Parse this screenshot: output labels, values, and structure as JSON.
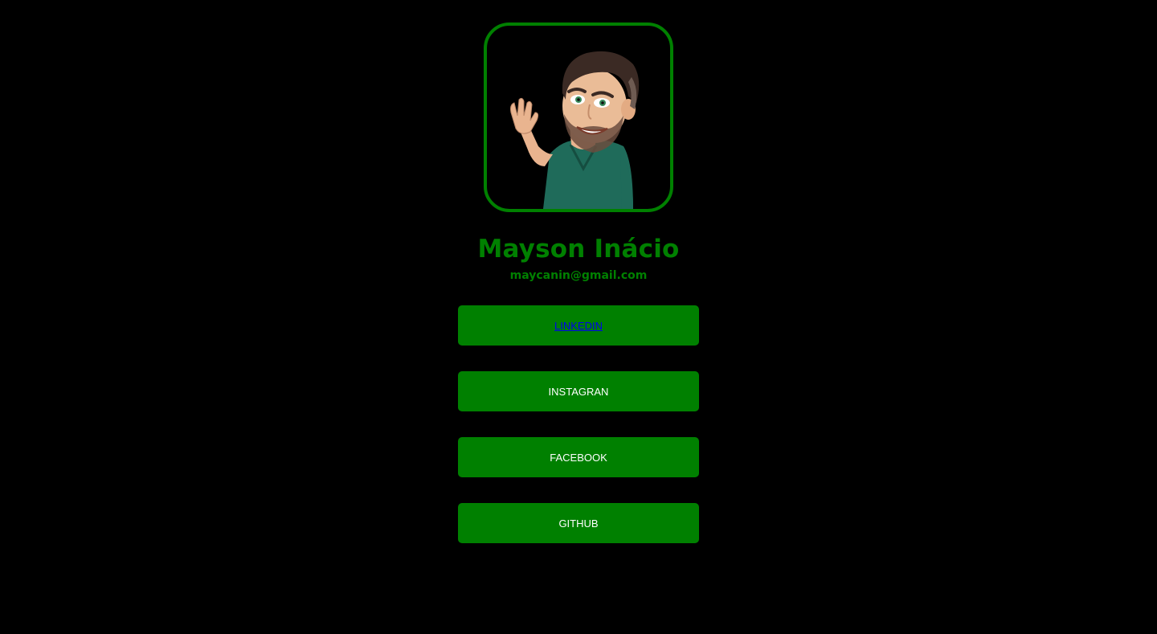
{
  "profile": {
    "name": "Mayson Inácio",
    "email": "maycanin@gmail.com",
    "avatar_icon": "avatar-illustration"
  },
  "links": [
    {
      "label": "LINKEDIN",
      "style": "hyperlink"
    },
    {
      "label": "INSTAGRAN",
      "style": "button"
    },
    {
      "label": "FACEBOOK",
      "style": "button"
    },
    {
      "label": "GITHUB",
      "style": "button"
    }
  ],
  "colors": {
    "background": "#000000",
    "accent": "#008000",
    "button_text": "#ffffff",
    "link_text": "#0000ee"
  }
}
